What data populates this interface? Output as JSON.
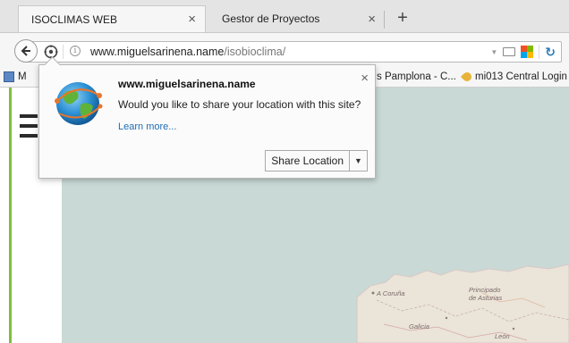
{
  "tabs": [
    {
      "title": "ISOCLIMAS WEB",
      "active": true
    },
    {
      "title": "Gestor de Proyectos",
      "active": false
    }
  ],
  "tab_close_glyph": "×",
  "new_tab_glyph": "+",
  "urlbar": {
    "host": "www.miguelsarinena.name",
    "path": "/isobioclima/"
  },
  "bookmarks": [
    {
      "label": "M",
      "icon": "bookmark-blue-icon"
    },
    {
      "label": "s Pamplona - C...",
      "icon": "none"
    },
    {
      "label": "mi013 Central Login",
      "icon": "key-icon"
    }
  ],
  "popup": {
    "host": "www.miguelsarinena.name",
    "message": "Would you like to share your location with this site?",
    "learn_more": "Learn more...",
    "share_button": "Share Location",
    "close_glyph": "×"
  },
  "map_labels": [
    {
      "text": "A Coruña"
    },
    {
      "text": "Principado"
    },
    {
      "text": "de Asturias"
    },
    {
      "text": "Galicia"
    },
    {
      "text": "León"
    }
  ],
  "colors": {
    "accent_link": "#1f6db3",
    "left_strip": "#7cbf3f",
    "map_sea": "#c9d9d5",
    "map_land": "#ebe4d8"
  },
  "icons": {
    "back": "back-arrow-icon",
    "geo": "geolocation-icon",
    "info": "info-icon",
    "reload": "reload-icon",
    "globe": "globe-icon",
    "menu": "hamburger-menu-icon"
  }
}
